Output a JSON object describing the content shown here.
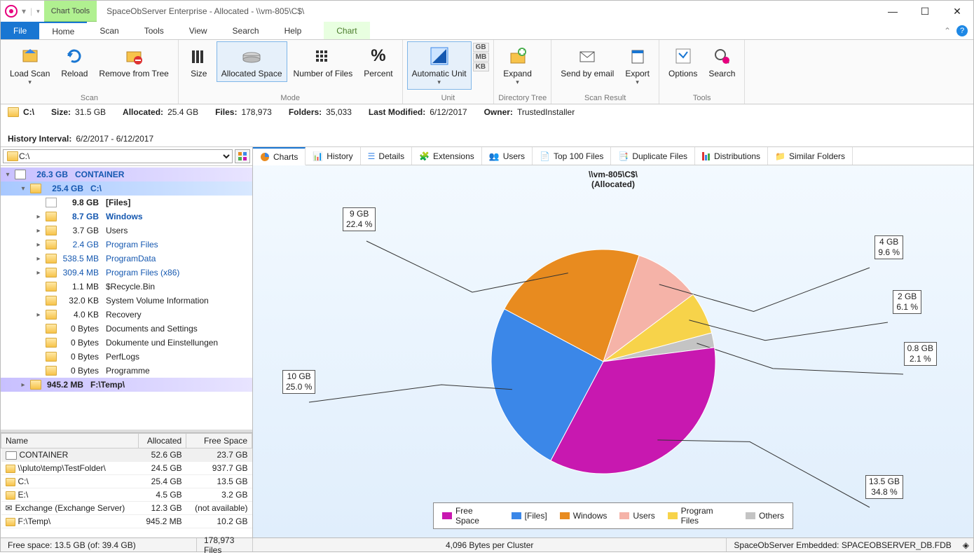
{
  "window": {
    "chart_tools": "Chart Tools",
    "title": "SpaceObServer Enterprise - Allocated - \\\\vm-805\\C$\\"
  },
  "menu": {
    "file": "File",
    "home": "Home",
    "scan": "Scan",
    "tools": "Tools",
    "view": "View",
    "search": "Search",
    "help": "Help",
    "chart": "Chart"
  },
  "ribbon": {
    "scan": {
      "load": "Load Scan",
      "reload": "Reload",
      "remove": "Remove from Tree",
      "group": "Scan"
    },
    "mode": {
      "size": "Size",
      "alloc": "Allocated Space",
      "nof": "Number of Files",
      "pct": "Percent",
      "group": "Mode"
    },
    "unit": {
      "auto": "Automatic Unit",
      "gb": "GB",
      "mb": "MB",
      "kb": "KB",
      "group": "Unit"
    },
    "dir": {
      "expand": "Expand",
      "group": "Directory Tree"
    },
    "res": {
      "send": "Send by email",
      "export": "Export",
      "group": "Scan Result"
    },
    "tools": {
      "options": "Options",
      "search": "Search",
      "group": "Tools"
    }
  },
  "info": {
    "drive_lbl": "C:\\",
    "size_lbl": "Size:",
    "size_val": "31.5 GB",
    "alloc_lbl": "Allocated:",
    "alloc_val": "25.4 GB",
    "files_lbl": "Files:",
    "files_val": "178,973",
    "folders_lbl": "Folders:",
    "folders_val": "35,033",
    "lm_lbl": "Last Modified:",
    "lm_val": "6/12/2017",
    "owner_lbl": "Owner:",
    "owner_val": "TrustedInstaller",
    "hist_lbl": "History Interval:",
    "hist_val": "6/2/2017 - 6/12/2017"
  },
  "path": "C:\\",
  "tree": [
    {
      "ind": 0,
      "exp": "▾",
      "sz": "26.3 GB",
      "nm": "CONTAINER",
      "bold": true,
      "blue": true,
      "hl": "hl-purple",
      "drive": true
    },
    {
      "ind": 1,
      "exp": "▾",
      "sz": "25.4 GB",
      "nm": "C:\\",
      "bold": true,
      "blue": true,
      "hl": "hl-blue"
    },
    {
      "ind": 2,
      "exp": "",
      "sz": "9.8 GB",
      "nm": "[Files]",
      "bold": true,
      "file": true
    },
    {
      "ind": 2,
      "exp": "▸",
      "sz": "8.7 GB",
      "nm": "Windows",
      "bold": true,
      "blue": true
    },
    {
      "ind": 2,
      "exp": "▸",
      "sz": "3.7 GB",
      "nm": "Users"
    },
    {
      "ind": 2,
      "exp": "▸",
      "sz": "2.4 GB",
      "nm": "Program Files",
      "blue": true
    },
    {
      "ind": 2,
      "exp": "▸",
      "sz": "538.5 MB",
      "nm": "ProgramData",
      "blue": true
    },
    {
      "ind": 2,
      "exp": "▸",
      "sz": "309.4 MB",
      "nm": "Program Files (x86)",
      "blue": true
    },
    {
      "ind": 2,
      "exp": "",
      "sz": "1.1 MB",
      "nm": "$Recycle.Bin"
    },
    {
      "ind": 2,
      "exp": "",
      "sz": "32.0 KB",
      "nm": "System Volume Information"
    },
    {
      "ind": 2,
      "exp": "▸",
      "sz": "4.0 KB",
      "nm": "Recovery"
    },
    {
      "ind": 2,
      "exp": "",
      "sz": "0 Bytes",
      "nm": "Documents and Settings",
      "link": true
    },
    {
      "ind": 2,
      "exp": "",
      "sz": "0 Bytes",
      "nm": "Dokumente und Einstellungen",
      "link": true
    },
    {
      "ind": 2,
      "exp": "",
      "sz": "0 Bytes",
      "nm": "PerfLogs"
    },
    {
      "ind": 2,
      "exp": "",
      "sz": "0 Bytes",
      "nm": "Programme",
      "link": true
    },
    {
      "ind": 1,
      "exp": "▸",
      "sz": "945.2 MB",
      "nm": "F:\\Temp\\",
      "bold": true,
      "hl": "hl-purple"
    }
  ],
  "grid": {
    "h_name": "Name",
    "h_alloc": "Allocated",
    "h_free": "Free Space",
    "rows": [
      {
        "n": "CONTAINER",
        "a": "52.6 GB",
        "f": "23.7 GB",
        "sel": true,
        "drive": true
      },
      {
        "n": "\\\\pluto\\temp\\TestFolder\\",
        "a": "24.5 GB",
        "f": "937.7 GB"
      },
      {
        "n": "C:\\",
        "a": "25.4 GB",
        "f": "13.5 GB"
      },
      {
        "n": "E:\\",
        "a": "4.5 GB",
        "f": "3.2 GB"
      },
      {
        "n": "Exchange (Exchange Server)",
        "a": "12.3 GB",
        "f": "(not available)",
        "exch": true
      },
      {
        "n": "F:\\Temp\\",
        "a": "945.2 MB",
        "f": "10.2 GB"
      }
    ]
  },
  "tabs": {
    "charts": "Charts",
    "history": "History",
    "details": "Details",
    "ext": "Extensions",
    "users": "Users",
    "top": "Top 100 Files",
    "dup": "Duplicate Files",
    "dist": "Distributions",
    "sim": "Similar Folders"
  },
  "chart": {
    "t1": "\\\\vm-805\\C$\\",
    "t2": "(Allocated)"
  },
  "callouts": {
    "files": {
      "l1": "10 GB",
      "l2": "25.0 %"
    },
    "win": {
      "l1": "9 GB",
      "l2": "22.4 %"
    },
    "users": {
      "l1": "4 GB",
      "l2": "9.6 %"
    },
    "pf": {
      "l1": "2 GB",
      "l2": "6.1 %"
    },
    "oth": {
      "l1": "0.8 GB",
      "l2": "2.1 %"
    },
    "free": {
      "l1": "13.5 GB",
      "l2": "34.8 %"
    }
  },
  "legend": {
    "free": "Free Space",
    "files": "[Files]",
    "win": "Windows",
    "users": "Users",
    "pf": "Program Files",
    "oth": "Others"
  },
  "status": {
    "free": "Free space: 13.5 GB (of: 39.4 GB)",
    "files": "178,973 Files",
    "cluster": "4,096 Bytes per Cluster",
    "db": "SpaceObServer Embedded: SPACEOBSERVER_DB.FDB"
  },
  "chart_data": {
    "type": "pie",
    "title": "\\\\vm-805\\C$\\ (Allocated)",
    "series": [
      {
        "name": "Free Space",
        "value": 13.5,
        "unit": "GB",
        "pct": 34.8,
        "color": "#c818b0"
      },
      {
        "name": "[Files]",
        "value": 10,
        "unit": "GB",
        "pct": 25.0,
        "color": "#3b87e8"
      },
      {
        "name": "Windows",
        "value": 9,
        "unit": "GB",
        "pct": 22.4,
        "color": "#e88b1f"
      },
      {
        "name": "Users",
        "value": 4,
        "unit": "GB",
        "pct": 9.6,
        "color": "#f5b3a8"
      },
      {
        "name": "Program Files",
        "value": 2,
        "unit": "GB",
        "pct": 6.1,
        "color": "#f7d34a"
      },
      {
        "name": "Others",
        "value": 0.8,
        "unit": "GB",
        "pct": 2.1,
        "color": "#c4c4c4"
      }
    ]
  }
}
